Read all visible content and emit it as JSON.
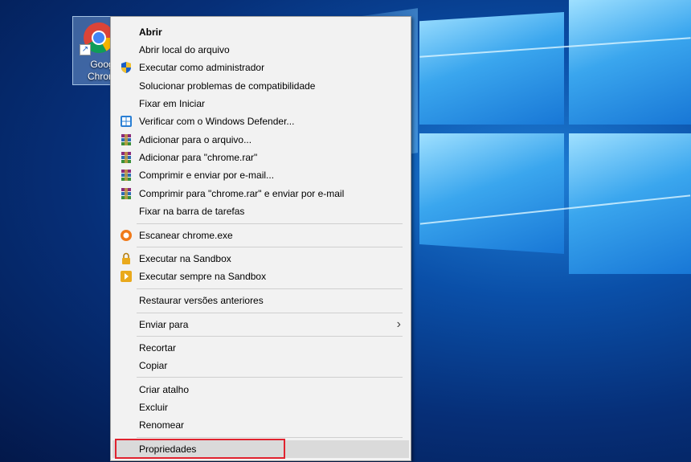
{
  "desktop": {
    "icon_label": "Goog\nChrom"
  },
  "menu": {
    "items": [
      {
        "label": "Abrir",
        "icon": "",
        "bold": true
      },
      {
        "label": "Abrir local do arquivo",
        "icon": ""
      },
      {
        "label": "Executar como administrador",
        "icon": "uac-shield-icon"
      },
      {
        "label": "Solucionar problemas de compatibilidade",
        "icon": ""
      },
      {
        "label": "Fixar em Iniciar",
        "icon": ""
      },
      {
        "label": "Verificar com o Windows Defender...",
        "icon": "windows-defender-icon"
      },
      {
        "label": "Adicionar para o arquivo...",
        "icon": "winrar-icon"
      },
      {
        "label": "Adicionar para \"chrome.rar\"",
        "icon": "winrar-icon"
      },
      {
        "label": "Comprimir e enviar por e-mail...",
        "icon": "winrar-icon"
      },
      {
        "label": "Comprimir para \"chrome.rar\" e enviar por e-mail",
        "icon": "winrar-icon"
      },
      {
        "label": "Fixar na barra de tarefas",
        "icon": ""
      },
      {
        "label": "Escanear chrome.exe",
        "icon": "avast-icon"
      },
      {
        "label": "Executar na Sandbox",
        "icon": "sandbox-lock-icon"
      },
      {
        "label": "Executar sempre na Sandbox",
        "icon": "sandbox-arrow-icon"
      },
      {
        "label": "Restaurar versões anteriores",
        "icon": ""
      },
      {
        "label": "Enviar para",
        "icon": "",
        "submenu": true
      },
      {
        "label": "Recortar",
        "icon": ""
      },
      {
        "label": "Copiar",
        "icon": ""
      },
      {
        "label": "Criar atalho",
        "icon": ""
      },
      {
        "label": "Excluir",
        "icon": ""
      },
      {
        "label": "Renomear",
        "icon": ""
      },
      {
        "label": "Propriedades",
        "icon": "",
        "highlighted": true
      }
    ],
    "submenu_arrow": "›"
  },
  "colors": {
    "menu_bg": "#f2f2f2",
    "hover_bg": "#dadada",
    "highlight_border": "#e0232f",
    "desktop_blue": "#0a4fa8"
  }
}
